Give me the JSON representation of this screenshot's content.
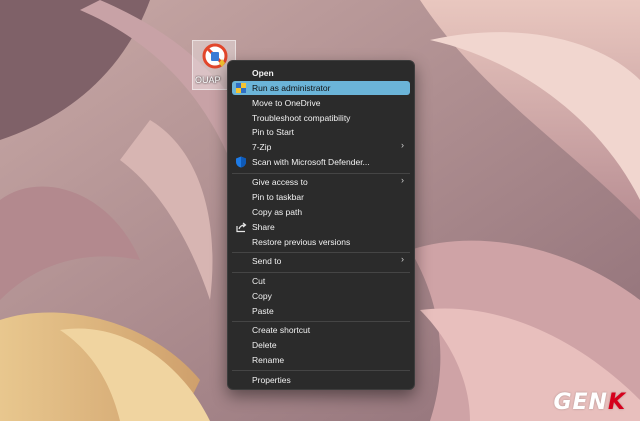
{
  "desktop": {
    "icon": {
      "name": "OUAP",
      "icon": "app-shield-icon"
    }
  },
  "context_menu": {
    "items": [
      {
        "label": "Open",
        "bold": true
      },
      {
        "label": "Run as administrator",
        "icon": "admin-shield-icon",
        "highlighted": true
      },
      {
        "label": "Move to OneDrive"
      },
      {
        "label": "Troubleshoot compatibility"
      },
      {
        "label": "Pin to Start"
      },
      {
        "label": "7-Zip",
        "submenu": true
      },
      {
        "label": "Scan with Microsoft Defender...",
        "icon": "defender-shield-icon"
      },
      {
        "label": "Give access to",
        "submenu": true
      },
      {
        "label": "Pin to taskbar"
      },
      {
        "label": "Copy as path"
      },
      {
        "label": "Share",
        "icon": "share-icon"
      },
      {
        "label": "Restore previous versions"
      },
      {
        "label": "Send to",
        "submenu": true
      },
      {
        "label": "Cut"
      },
      {
        "label": "Copy"
      },
      {
        "label": "Paste"
      },
      {
        "label": "Create shortcut"
      },
      {
        "label": "Delete"
      },
      {
        "label": "Rename"
      },
      {
        "label": "Properties"
      }
    ]
  },
  "watermark": {
    "text_main": "GEN",
    "text_accent": "K"
  },
  "colors": {
    "menu_bg": "#2b2b2b",
    "highlight": "#6bb4d8",
    "watermark_accent": "#d6001c"
  }
}
